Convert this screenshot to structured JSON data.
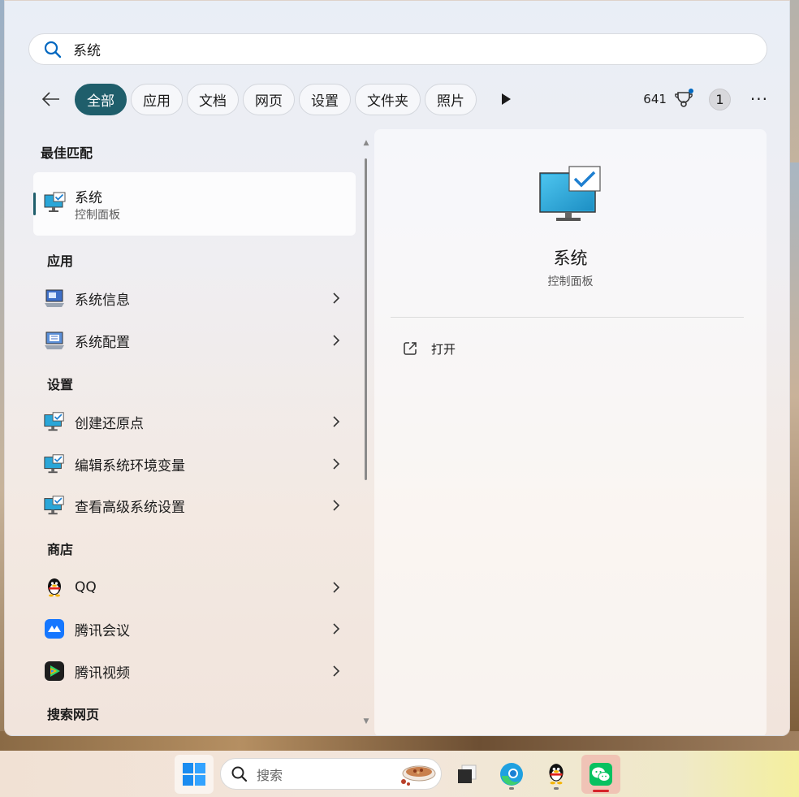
{
  "search": {
    "value": "系统",
    "icon": "search-icon"
  },
  "filters": {
    "tabs": [
      "全部",
      "应用",
      "文档",
      "网页",
      "设置",
      "文件夹",
      "照片"
    ],
    "active_index": 0,
    "points": "641",
    "badge_count": "1",
    "more": "···"
  },
  "results": {
    "best_match_title": "最佳匹配",
    "best_match": {
      "label": "系统",
      "sub": "控制面板"
    },
    "apps_title": "应用",
    "apps": [
      {
        "label": "系统信息",
        "icon": "system-info-icon"
      },
      {
        "label": "系统配置",
        "icon": "system-config-icon"
      }
    ],
    "settings_title": "设置",
    "settings": [
      {
        "label": "创建还原点",
        "icon": "monitor-check-icon"
      },
      {
        "label": "编辑系统环境变量",
        "icon": "monitor-check-icon"
      },
      {
        "label": "查看高级系统设置",
        "icon": "monitor-check-icon"
      }
    ],
    "store_title": "商店",
    "store": [
      {
        "label": "QQ",
        "icon": "qq-penguin-icon"
      },
      {
        "label": "腾讯会议",
        "icon": "tencent-meeting-icon"
      },
      {
        "label": "腾讯视频",
        "icon": "tencent-video-icon"
      }
    ],
    "web_title": "搜索网页"
  },
  "preview": {
    "title": "系统",
    "sub": "控制面板",
    "action_label": "打开"
  },
  "taskbar": {
    "search_label": "搜索"
  },
  "colors": {
    "accent": "#1f5e6b",
    "link_blue": "#0067c0",
    "wechat_green": "#07c160"
  }
}
